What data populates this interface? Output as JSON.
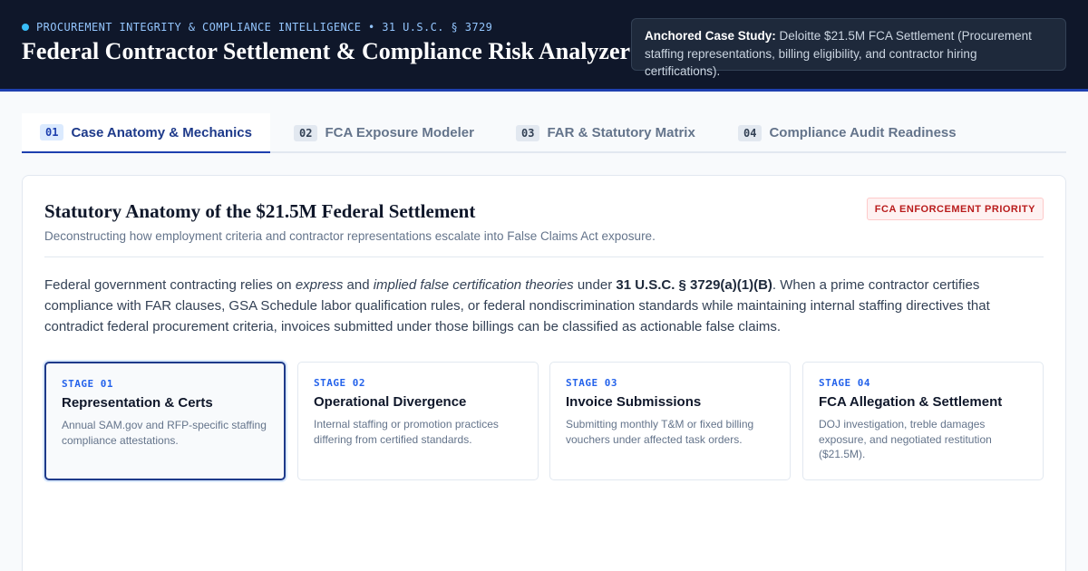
{
  "header": {
    "eyebrow": "PROCUREMENT INTEGRITY & COMPLIANCE INTELLIGENCE • 31 U.S.C. § 3729",
    "title": "Federal Contractor Settlement & Compliance Risk Analyzer",
    "case_label": "Anchored Case Study:",
    "case_text": " Deloitte $21.5M FCA Settlement (Procurement staffing representations, billing eligibility, and contractor hiring certifications)."
  },
  "tabs": [
    {
      "num": "01",
      "label": "Case Anatomy & Mechanics",
      "active": true
    },
    {
      "num": "02",
      "label": "FCA Exposure Modeler",
      "active": false
    },
    {
      "num": "03",
      "label": "FAR & Statutory Matrix",
      "active": false
    },
    {
      "num": "04",
      "label": "Compliance Audit Readiness",
      "active": false
    }
  ],
  "panel": {
    "title": "Statutory Anatomy of the $21.5M Federal Settlement",
    "badge": "FCA ENFORCEMENT PRIORITY",
    "subtitle": "Deconstructing how employment criteria and contractor representations escalate into False Claims Act exposure.",
    "intro": {
      "p1": "Federal government contracting relies on ",
      "em1": "express",
      "p2": " and ",
      "em2": "implied false certification theories",
      "p3": " under ",
      "statute": "31 U.S.C. § 3729(a)(1)(B)",
      "p4": ". When a prime contractor certifies compliance with FAR clauses, GSA Schedule labor qualification rules, or federal nondiscrimination standards while maintaining internal staffing directives that contradict federal procurement criteria, invoices submitted under those billings can be classified as actionable false claims."
    }
  },
  "stages": [
    {
      "label": "STAGE 01",
      "title": "Representation & Certs",
      "desc": "Annual SAM.gov and RFP-specific staffing compliance attestations."
    },
    {
      "label": "STAGE 02",
      "title": "Operational Divergence",
      "desc": "Internal staffing or promotion practices differing from certified standards."
    },
    {
      "label": "STAGE 03",
      "title": "Invoice Submissions",
      "desc": "Submitting monthly T&M or fixed billing vouchers under affected task orders."
    },
    {
      "label": "STAGE 04",
      "title": "FCA Allegation & Settlement",
      "desc": "DOJ investigation, treble damages exposure, and negotiated restitution ($21.5M)."
    }
  ]
}
